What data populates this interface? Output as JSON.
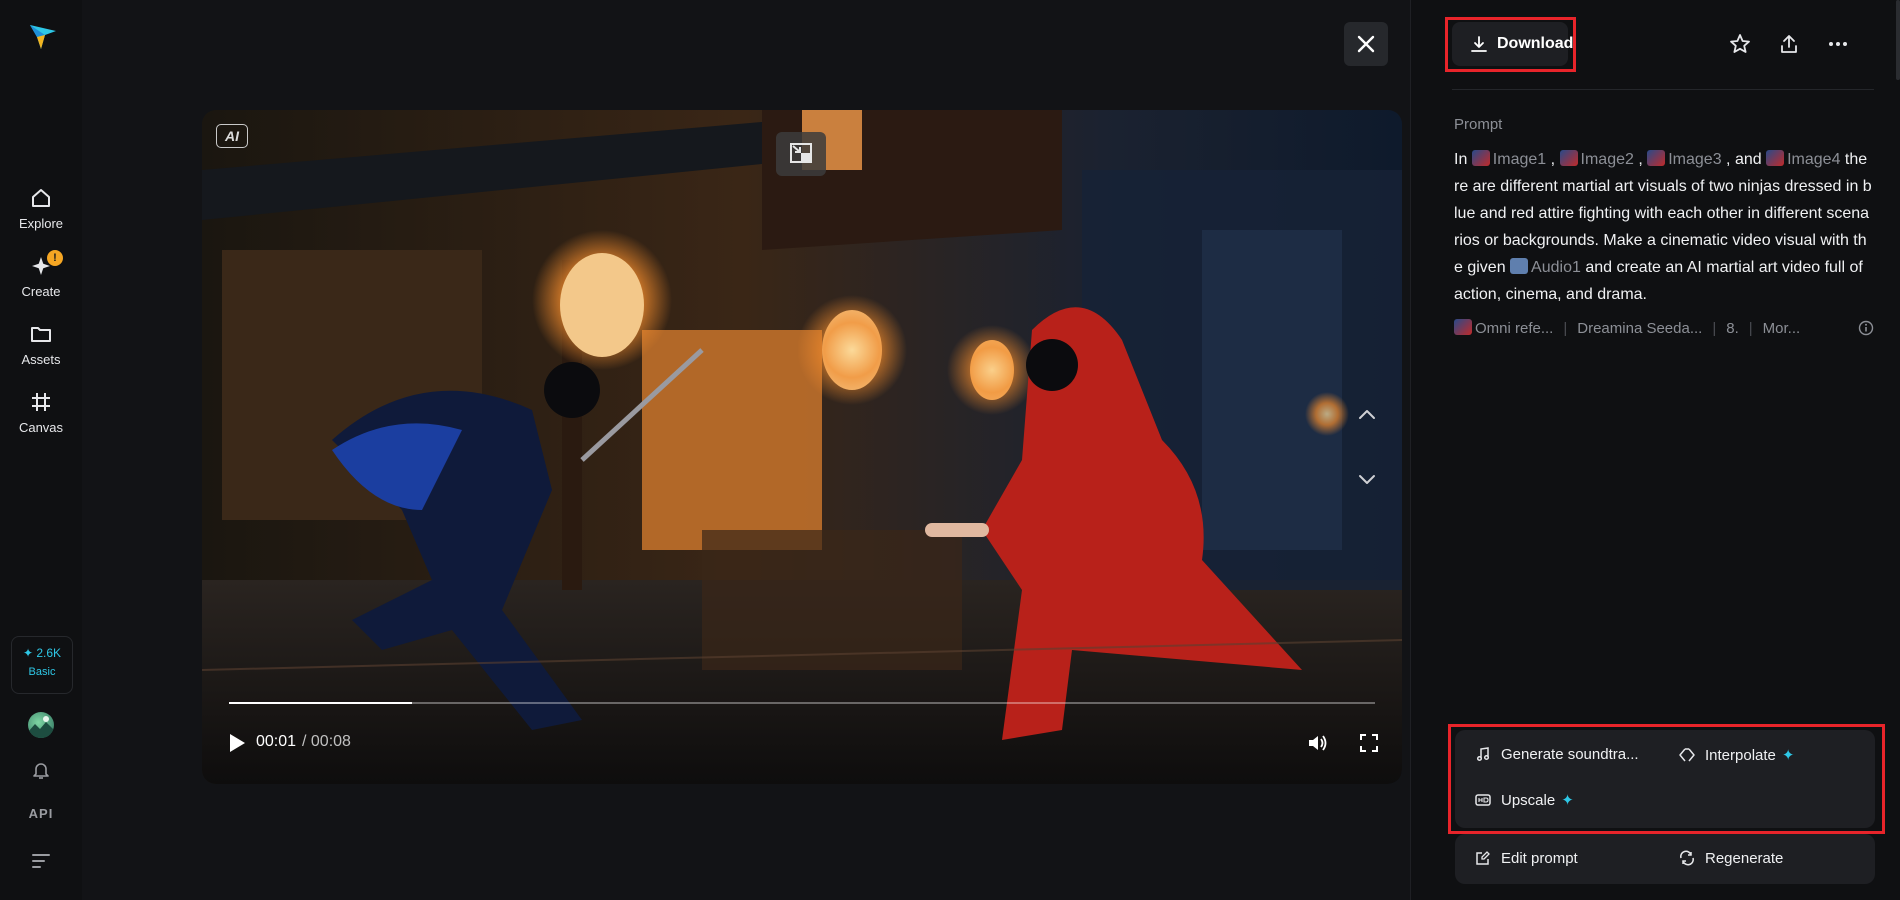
{
  "sidebar": {
    "items": [
      {
        "label": "Explore",
        "icon": "home-icon"
      },
      {
        "label": "Create",
        "icon": "create-icon",
        "badge": "!"
      },
      {
        "label": "Assets",
        "icon": "folder-icon"
      },
      {
        "label": "Canvas",
        "icon": "canvas-icon"
      }
    ],
    "credits": {
      "amount": "✦ 2.6K",
      "plan": "Basic"
    },
    "api_label": "API"
  },
  "viewer": {
    "ai_tag": "AI",
    "time_current": "00:01",
    "time_total": "/ 00:08",
    "progress": 0.16
  },
  "panel": {
    "download_label": "Download",
    "prompt_label": "Prompt",
    "prompt": {
      "p1": "In ",
      "ref1": "Image1",
      "p2": " , ",
      "ref2": "Image2",
      "p3": " , ",
      "ref3": "Image3",
      "p4": " , and ",
      "ref4": "Image4",
      "p5": " there are different martial art visuals of two ninjas dressed in blue and red attire fighting with each other in different scenarios or backgrounds. Make a cinematic video visual with the given ",
      "ref5": "Audio1",
      "p6": " and create an AI martial art video full of action, cinema, and drama."
    },
    "meta": {
      "mode": "Omni refe...",
      "model": "Dreamina Seeda...",
      "duration": "8.",
      "more": "Mor..."
    },
    "actions": {
      "soundtrack": "Generate soundtra...",
      "interpolate": "Interpolate",
      "upscale": "Upscale",
      "edit_prompt": "Edit prompt",
      "regenerate": "Regenerate",
      "spark": "✦"
    }
  },
  "colors": {
    "accent": "#2ec7e6",
    "highlight": "#e8242a",
    "badge": "#f5a623"
  }
}
